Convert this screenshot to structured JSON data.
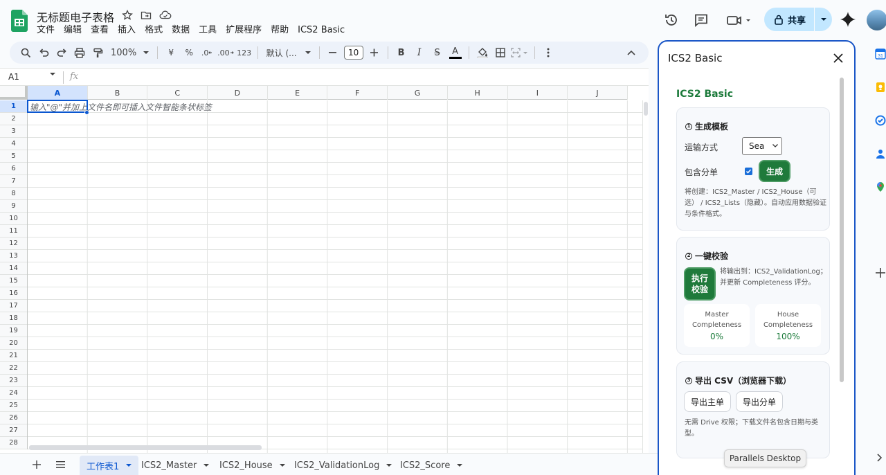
{
  "header": {
    "doc_title": "无标题电子表格",
    "menu": [
      "文件",
      "编辑",
      "查看",
      "插入",
      "格式",
      "数据",
      "工具",
      "扩展程序",
      "帮助",
      "ICS2 Basic"
    ],
    "share_label": "共享"
  },
  "toolbar": {
    "zoom": "100%",
    "currency": "¥",
    "percent": "%",
    "decrease_decimal": ".0",
    "increase_decimal": ".00",
    "number_format": "123",
    "font": "默认 (...",
    "font_size": "10",
    "bold": "B",
    "italic": "I",
    "strikethrough": "S",
    "text_color": "A"
  },
  "formula_bar": {
    "name_box": "A1",
    "fx": "fx"
  },
  "grid": {
    "columns": [
      "A",
      "B",
      "C",
      "D",
      "E",
      "F",
      "G",
      "H",
      "I",
      "J"
    ],
    "rows": [
      "1",
      "2",
      "3",
      "4",
      "5",
      "6",
      "7",
      "8",
      "9",
      "10",
      "11",
      "12",
      "13",
      "14",
      "15",
      "16",
      "17",
      "18",
      "19",
      "20",
      "21",
      "22",
      "23",
      "24",
      "25",
      "26",
      "27",
      "28"
    ],
    "active_cell": "A1",
    "cell_hint": "输入\"@\"并加上文件名即可插入文件智能条状标签"
  },
  "sheets": {
    "tabs": [
      "工作表1",
      "ICS2_Master",
      "ICS2_House",
      "ICS2_ValidationLog",
      "ICS2_Score"
    ],
    "active": "工作表1"
  },
  "sidepanel": {
    "title": "ICS2 Basic",
    "app_title": "ICS2 Basic",
    "generate": {
      "heading": "生成模板",
      "step": "1",
      "transport_label": "运输方式",
      "transport_value": "Sea",
      "include_label": "包含分单",
      "include_checked": true,
      "button": "生成",
      "note": "将创建：ICS2_Master / ICS2_House（可选） / ICS2_Lists（隐藏）。自动应用数据验证与条件格式。"
    },
    "validate": {
      "heading": "一键校验",
      "step": "2",
      "button_line1": "执行",
      "button_line2": "校验",
      "note": "将输出到：ICS2_ValidationLog；并更新 Completeness 评分。",
      "master_label_1": "Master",
      "master_label_2": "Completeness",
      "master_value": "0%",
      "house_label_1": "House",
      "house_label_2": "Completeness",
      "house_value": "100%"
    },
    "export": {
      "heading": "导出 CSV（浏览器下载）",
      "step": "3",
      "btn_master": "导出主单",
      "btn_house": "导出分单",
      "note": "无需 Drive 权限；下载文件名包含日期与类型。"
    }
  },
  "tooltip": "Parallels Desktop",
  "colors": {
    "accent_blue": "#0b57d0",
    "share_bg": "#c2e7ff",
    "green": "#1f7a3b",
    "panel_border": "#1a56c7"
  }
}
